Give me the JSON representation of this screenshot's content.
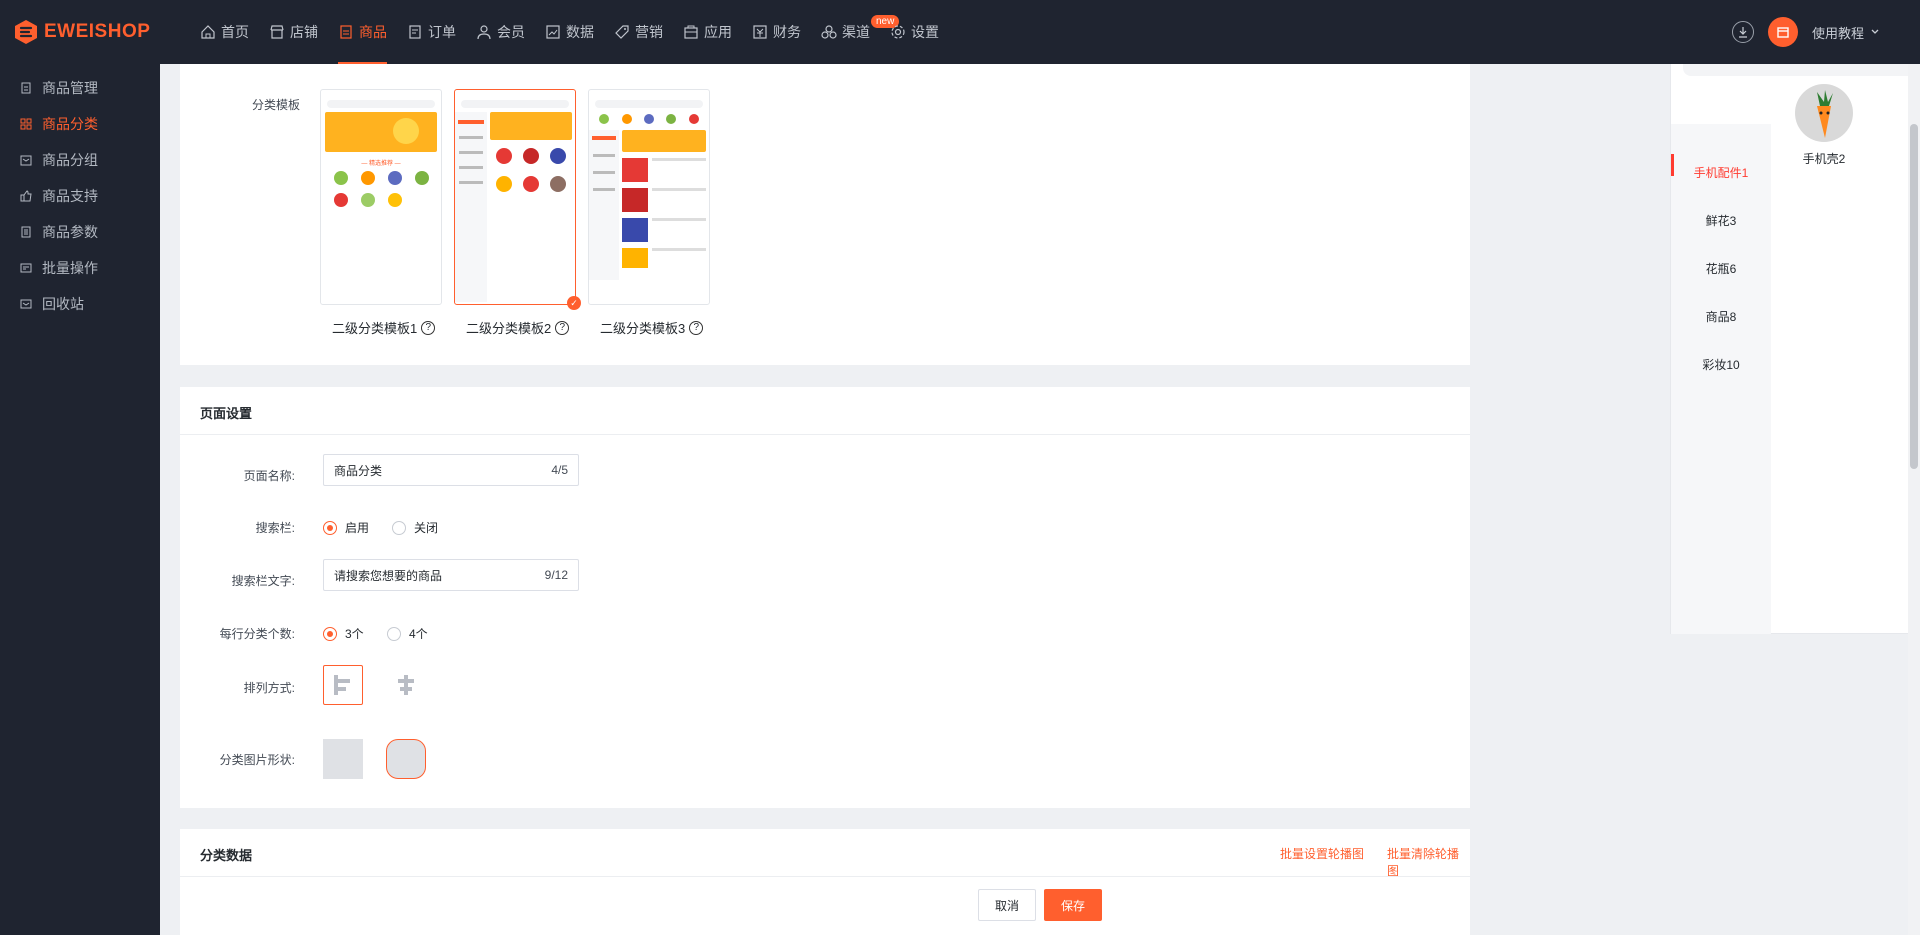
{
  "brand": {
    "name": "EWEISHOP",
    "color": "#ff5f2e"
  },
  "nav": [
    {
      "label": "首页",
      "icon": "home-icon",
      "active": false
    },
    {
      "label": "店铺",
      "icon": "store-icon",
      "active": false
    },
    {
      "label": "商品",
      "icon": "goods-icon",
      "active": true
    },
    {
      "label": "订单",
      "icon": "order-icon",
      "active": false
    },
    {
      "label": "会员",
      "icon": "member-icon",
      "active": false
    },
    {
      "label": "数据",
      "icon": "chart-icon",
      "active": false
    },
    {
      "label": "营销",
      "icon": "tag-icon",
      "active": false
    },
    {
      "label": "应用",
      "icon": "app-icon",
      "active": false
    },
    {
      "label": "财务",
      "icon": "finance-icon",
      "active": false
    },
    {
      "label": "渠道",
      "icon": "channel-icon",
      "active": false,
      "badge": "new"
    },
    {
      "label": "设置",
      "icon": "gear-icon",
      "active": false
    }
  ],
  "topright": {
    "help_label": "使用教程"
  },
  "sidebar": [
    {
      "label": "商品管理",
      "active": false
    },
    {
      "label": "商品分类",
      "active": true
    },
    {
      "label": "商品分组",
      "active": false
    },
    {
      "label": "商品支持",
      "active": false
    },
    {
      "label": "商品参数",
      "active": false
    },
    {
      "label": "批量操作",
      "active": false
    },
    {
      "label": "回收站",
      "active": false
    }
  ],
  "template": {
    "label": "分类模板",
    "options": [
      {
        "name": "二级分类模板1",
        "selected": false
      },
      {
        "name": "二级分类模板2",
        "selected": true
      },
      {
        "name": "二级分类模板3",
        "selected": false
      }
    ]
  },
  "page_settings": {
    "title": "页面设置",
    "page_name": {
      "label": "页面名称:",
      "value": "商品分类",
      "count": "4/5"
    },
    "search_bar": {
      "label": "搜索栏:",
      "options": [
        "启用",
        "关闭"
      ],
      "selected": "启用"
    },
    "search_text": {
      "label": "搜索栏文字:",
      "value": "请搜索您想要的商品",
      "count": "9/12"
    },
    "per_row": {
      "label": "每行分类个数:",
      "options": [
        "3个",
        "4个"
      ],
      "selected": "3个"
    },
    "layout": {
      "label": "排列方式:"
    },
    "image_shape": {
      "label": "分类图片形状:"
    }
  },
  "category_data": {
    "title": "分类数据",
    "batch_set": "批量设置轮播图",
    "batch_clear": "批量清除轮播图"
  },
  "footer": {
    "cancel": "取消",
    "save": "保存"
  },
  "preview": {
    "categories": [
      {
        "label": "手机配件1",
        "active": true
      },
      {
        "label": "鲜花3",
        "active": false
      },
      {
        "label": "花瓶6",
        "active": false
      },
      {
        "label": "商品8",
        "active": false
      },
      {
        "label": "彩妆10",
        "active": false
      }
    ],
    "product": {
      "name": "手机壳2"
    }
  }
}
